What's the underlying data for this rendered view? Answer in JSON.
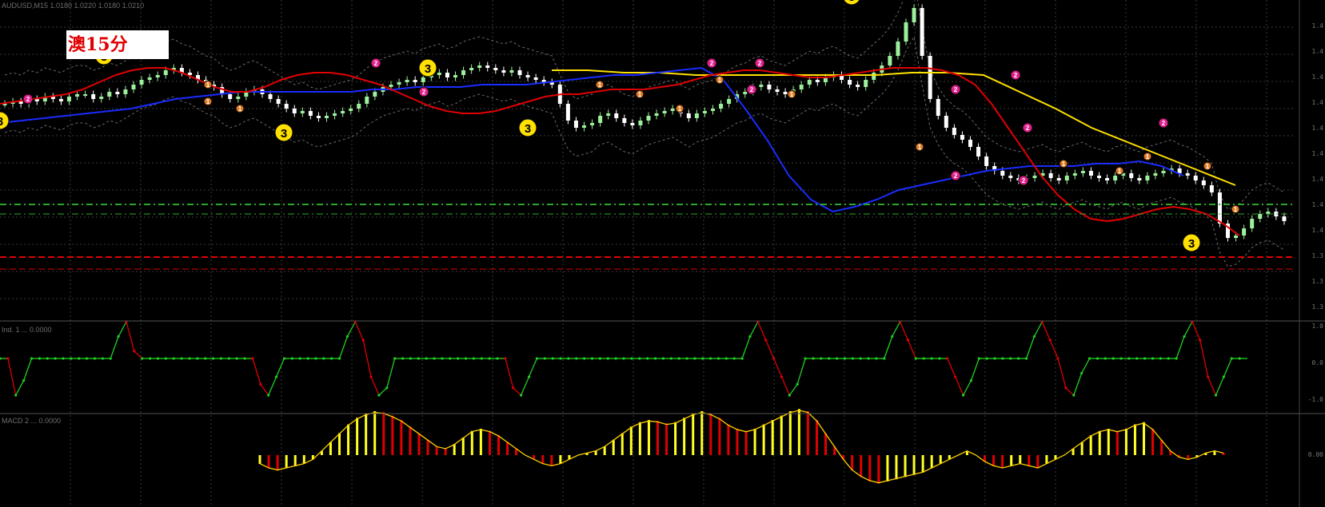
{
  "labels": {
    "title": "澳15分",
    "main_header": "AUDUSD,M15  1.0180 1.0220 1.0180 1.0210",
    "osc_header": "Ind. 1 ... 0.0000",
    "macd_header": "MACD 2 ... 0.0000"
  },
  "colors": {
    "bull_candle": "#9cf09c",
    "bear_candle": "#ffffff",
    "ema_fast": "#e00000",
    "ema_slow": "#1a2cff",
    "ema_long": "#ffe000",
    "bands": "#6a6a6a",
    "marker_3": "#ffe000",
    "marker_2": "#e0208a",
    "marker_1": "#e07a20",
    "level_green": "#2da82d",
    "level_red": "#e00000",
    "macd_up": "#ffff20",
    "macd_down": "#e00000",
    "macd_signal": "#ffd000"
  },
  "chart_data": [
    {
      "type": "candlestick",
      "title": "",
      "candles_close": [
        40,
        41,
        40,
        42,
        41,
        43,
        42,
        41,
        43,
        44,
        44,
        42,
        43,
        45,
        44,
        46,
        48,
        50,
        51,
        52,
        54,
        55,
        53,
        52,
        50,
        48,
        47,
        44,
        42,
        43,
        45,
        46,
        44,
        42,
        40,
        38,
        36,
        37,
        35,
        34,
        35,
        36,
        37,
        38,
        40,
        43,
        45,
        47,
        48,
        49,
        50,
        49,
        51,
        52,
        53,
        51,
        52,
        54,
        55,
        56,
        55,
        54,
        53,
        54,
        52,
        51,
        50,
        49,
        48,
        40,
        33,
        30,
        31,
        32,
        35,
        36,
        34,
        32,
        31,
        33,
        35,
        36,
        37,
        38,
        36,
        34,
        36,
        37,
        38,
        40,
        42,
        44,
        45,
        47,
        48,
        46,
        45,
        44,
        46,
        48,
        50,
        49,
        51,
        52,
        50,
        48,
        47,
        50,
        53,
        56,
        60,
        66,
        74,
        80,
        60,
        42,
        35,
        30,
        27,
        25,
        22,
        18,
        14,
        12,
        10,
        9,
        8,
        9,
        10,
        11,
        9,
        8,
        10,
        11,
        12,
        10,
        9,
        8,
        10,
        11,
        9,
        8,
        10,
        11,
        12,
        13,
        11,
        10,
        8,
        6,
        3,
        -10,
        -16,
        -15,
        -12,
        -8,
        -6,
        -5,
        -7,
        -9
      ],
      "ema_fast": [
        40,
        41,
        42,
        43,
        44,
        46,
        49,
        52,
        54,
        55,
        55,
        53,
        50,
        47,
        45,
        45,
        47,
        50,
        52,
        53,
        53,
        52,
        50,
        48,
        45,
        42,
        39,
        37,
        36,
        36,
        37,
        39,
        41,
        43,
        44,
        44,
        45,
        46,
        46,
        46,
        47,
        48,
        50,
        52,
        53,
        54,
        54,
        53,
        52,
        51,
        51,
        52,
        53,
        54,
        55,
        55,
        55,
        54,
        52,
        48,
        40,
        30,
        20,
        10,
        2,
        -4,
        -8,
        -9,
        -8,
        -6,
        -4,
        -3,
        -4,
        -6,
        -10,
        -15
      ],
      "ema_slow": [
        32,
        33,
        34,
        35,
        36,
        37,
        38,
        40,
        42,
        43,
        44,
        45,
        45,
        45,
        45,
        45,
        45,
        46,
        46,
        47,
        47,
        47,
        48,
        48,
        48,
        49,
        50,
        51,
        52,
        52,
        53,
        54,
        55,
        50,
        38,
        25,
        10,
        0,
        -5,
        -3,
        0,
        4,
        6,
        8,
        10,
        12,
        13,
        14,
        14,
        14,
        15,
        15,
        16,
        14,
        10
      ],
      "ema_long": [
        54,
        54,
        53,
        53,
        52,
        52,
        52,
        52,
        52,
        52,
        53,
        53,
        52,
        45,
        38,
        30,
        24,
        18,
        12,
        6
      ],
      "marker_legend": [
        "3",
        "2",
        "1"
      ],
      "markers": [
        {
          "label": "3",
          "price": 33
        },
        {
          "label": "3",
          "price": 60
        },
        {
          "label": "3",
          "price": 28
        },
        {
          "label": "3",
          "price": 55
        },
        {
          "label": "3",
          "price": 30
        },
        {
          "label": "3",
          "price": 85
        },
        {
          "label": "3",
          "price": -18
        },
        {
          "label": "2",
          "price": 42
        },
        {
          "label": "2",
          "price": 57
        },
        {
          "label": "2",
          "price": 45
        },
        {
          "label": "2",
          "price": 57
        },
        {
          "label": "2",
          "price": 46
        },
        {
          "label": "2",
          "price": 57
        },
        {
          "label": "2",
          "price": 46
        },
        {
          "label": "2",
          "price": 52
        },
        {
          "label": "2",
          "price": 8
        },
        {
          "label": "2",
          "price": 32
        },
        {
          "label": "2",
          "price": 10
        },
        {
          "label": "2",
          "price": 30
        },
        {
          "label": "1",
          "price": 41
        },
        {
          "label": "1",
          "price": 38
        },
        {
          "label": "1",
          "price": 48
        },
        {
          "label": "1",
          "price": 48
        },
        {
          "label": "1",
          "price": 44
        },
        {
          "label": "1",
          "price": 38
        },
        {
          "label": "1",
          "price": 50
        },
        {
          "label": "1",
          "price": 44
        },
        {
          "label": "1",
          "price": 22
        },
        {
          "label": "1",
          "price": 15
        },
        {
          "label": "1",
          "price": 12
        },
        {
          "label": "1",
          "price": 14
        },
        {
          "label": "1",
          "price": 18
        },
        {
          "label": "1",
          "price": -4
        }
      ],
      "levels_green": [
        -2,
        -6
      ],
      "levels_red": [
        -24,
        -29
      ],
      "side_ticks": [
        "1.4",
        "1.4",
        "1.4",
        "1.4",
        "1.4",
        "1.4",
        "1.4",
        "1.4",
        "1.4",
        "1.3",
        "1.3",
        "1.3"
      ]
    },
    {
      "type": "line",
      "title": "",
      "levels": [
        "1.0",
        "0.0",
        "-1.0"
      ],
      "values": [
        0,
        0,
        -1,
        -0.6,
        0,
        0,
        0,
        0,
        0,
        0,
        0,
        0,
        0,
        0,
        0,
        0.6,
        1,
        0.2,
        0,
        0,
        0,
        0,
        0,
        0,
        0,
        0,
        0,
        0,
        0,
        0,
        0,
        0,
        0,
        -0.7,
        -1,
        -0.5,
        0,
        0,
        0,
        0,
        0,
        0,
        0,
        0,
        0.6,
        1,
        0.5,
        -0.5,
        -1,
        -0.8,
        0,
        0,
        0,
        0,
        0,
        0,
        0,
        0,
        0,
        0,
        0,
        0,
        0,
        0,
        0,
        -0.8,
        -1,
        -0.5,
        0,
        0,
        0,
        0,
        0,
        0,
        0,
        0,
        0,
        0,
        0,
        0,
        0,
        0,
        0,
        0,
        0,
        0,
        0,
        0,
        0,
        0,
        0,
        0,
        0,
        0,
        0,
        0.6,
        1,
        0.5,
        0,
        -0.5,
        -1,
        -0.7,
        0,
        0,
        0,
        0,
        0,
        0,
        0,
        0,
        0,
        0,
        0,
        0.6,
        1,
        0.5,
        0,
        0,
        0,
        0,
        0,
        -0.5,
        -1,
        -0.6,
        0,
        0,
        0,
        0,
        0,
        0,
        0,
        0.6,
        1,
        0.5,
        0,
        -0.8,
        -1,
        -0.4,
        0,
        0,
        0,
        0,
        0,
        0,
        0,
        0,
        0,
        0,
        0,
        0,
        0.6,
        1,
        0.5,
        -0.5,
        -1,
        -0.5,
        0,
        0,
        0
      ]
    },
    {
      "type": "bar",
      "title": "",
      "levels": [
        "0.00"
      ],
      "values": [
        -0.2,
        -0.3,
        -0.35,
        -0.3,
        -0.25,
        -0.2,
        -0.1,
        0.1,
        0.3,
        0.5,
        0.7,
        0.85,
        0.95,
        1.0,
        0.98,
        0.9,
        0.8,
        0.65,
        0.5,
        0.35,
        0.2,
        0.15,
        0.25,
        0.4,
        0.55,
        0.6,
        0.55,
        0.45,
        0.3,
        0.15,
        0,
        -0.1,
        -0.2,
        -0.25,
        -0.2,
        -0.1,
        0,
        0.05,
        0.1,
        0.2,
        0.35,
        0.5,
        0.65,
        0.75,
        0.8,
        0.78,
        0.72,
        0.75,
        0.85,
        0.95,
        1.0,
        0.95,
        0.85,
        0.7,
        0.6,
        0.55,
        0.6,
        0.7,
        0.8,
        0.9,
        1.0,
        1.05,
        1.0,
        0.8,
        0.5,
        0.2,
        -0.1,
        -0.35,
        -0.5,
        -0.6,
        -0.65,
        -0.6,
        -0.55,
        -0.5,
        -0.45,
        -0.4,
        -0.3,
        -0.2,
        -0.1,
        0,
        0.1,
        0,
        -0.15,
        -0.25,
        -0.3,
        -0.25,
        -0.2,
        -0.25,
        -0.3,
        -0.2,
        -0.1,
        0,
        0.15,
        0.3,
        0.45,
        0.55,
        0.6,
        0.55,
        0.6,
        0.7,
        0.75,
        0.6,
        0.35,
        0.1,
        -0.05,
        -0.1,
        -0.05,
        0.05,
        0.1,
        0.05
      ]
    }
  ]
}
